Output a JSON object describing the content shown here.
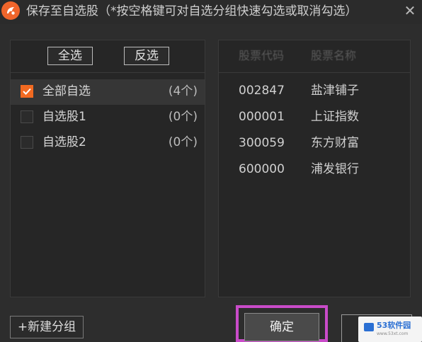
{
  "window": {
    "title": "保存至自选股（*按空格键可对自选分组快速勾选或取消勾选）",
    "close_symbol": "✕"
  },
  "left_panel": {
    "select_all_label": "全选",
    "invert_label": "反选",
    "groups": [
      {
        "name": "全部自选",
        "count": "(4个)",
        "checked": true
      },
      {
        "name": "自选股1",
        "count": "(0个)",
        "checked": false
      },
      {
        "name": "自选股2",
        "count": "(0个)",
        "checked": false
      }
    ]
  },
  "right_panel": {
    "columns": {
      "code": "股票代码",
      "name": "股票名称"
    },
    "stocks": [
      {
        "code": "002847",
        "name": "盐津铺子"
      },
      {
        "code": "000001",
        "name": "上证指数"
      },
      {
        "code": "300059",
        "name": "东方财富"
      },
      {
        "code": "600000",
        "name": "浦发银行"
      }
    ]
  },
  "footer": {
    "new_group_label": "+新建分组",
    "confirm_label": "确定",
    "cancel_label": ""
  },
  "watermark": {
    "text": "53软件园",
    "sub": "www.53xt.com"
  },
  "colors": {
    "accent": "#f26a21",
    "highlight": "#c94bc9",
    "background": "#2d2d2d"
  },
  "icons": {
    "app": "app-logo-icon",
    "close": "close-icon",
    "check": "checkmark-icon"
  }
}
